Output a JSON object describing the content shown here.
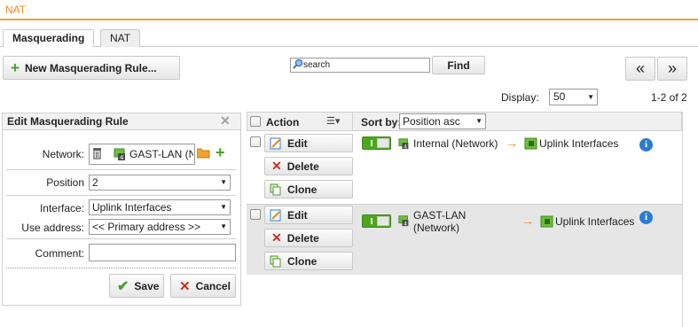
{
  "page": {
    "title": "NAT"
  },
  "tabs": [
    {
      "label": "Masquerading",
      "active": true
    },
    {
      "label": "NAT",
      "active": false
    }
  ],
  "toolbar": {
    "new_label": "New Masquerading Rule...",
    "search_placeholder": "search",
    "find_label": "Find",
    "prev_label": "«",
    "next_label": "»"
  },
  "pagination": {
    "display_label": "Display:",
    "display_value": "50",
    "range_label": "1-2 of 2"
  },
  "edit_panel": {
    "title": "Edit Masquerading Rule",
    "network_label": "Network:",
    "network_value": "GAST-LAN (N",
    "position_label": "Position",
    "position_value": "2",
    "interface_label": "Interface:",
    "interface_value": "Uplink Interfaces",
    "use_address_label": "Use address:",
    "use_address_value": "<< Primary address >>",
    "comment_label": "Comment:",
    "comment_value": "",
    "save_label": "Save",
    "cancel_label": "Cancel"
  },
  "grid": {
    "action_header": "Action",
    "sort_label": "Sort by:",
    "sort_value": "Position asc",
    "rows": [
      {
        "edit_label": "Edit",
        "delete_label": "Delete",
        "clone_label": "Clone",
        "enabled": true,
        "source": "Internal (Network)",
        "target": "Uplink Interfaces"
      },
      {
        "edit_label": "Edit",
        "delete_label": "Delete",
        "clone_label": "Clone",
        "enabled": true,
        "source_line1": "GAST-LAN",
        "source_line2": "(Network)",
        "target": "Uplink Interfaces"
      }
    ]
  },
  "colors": {
    "accent": "#f08a24",
    "toggle_on": "#4ea51e",
    "info": "#2b7bd3",
    "selected_row": "#e6e6e6"
  }
}
